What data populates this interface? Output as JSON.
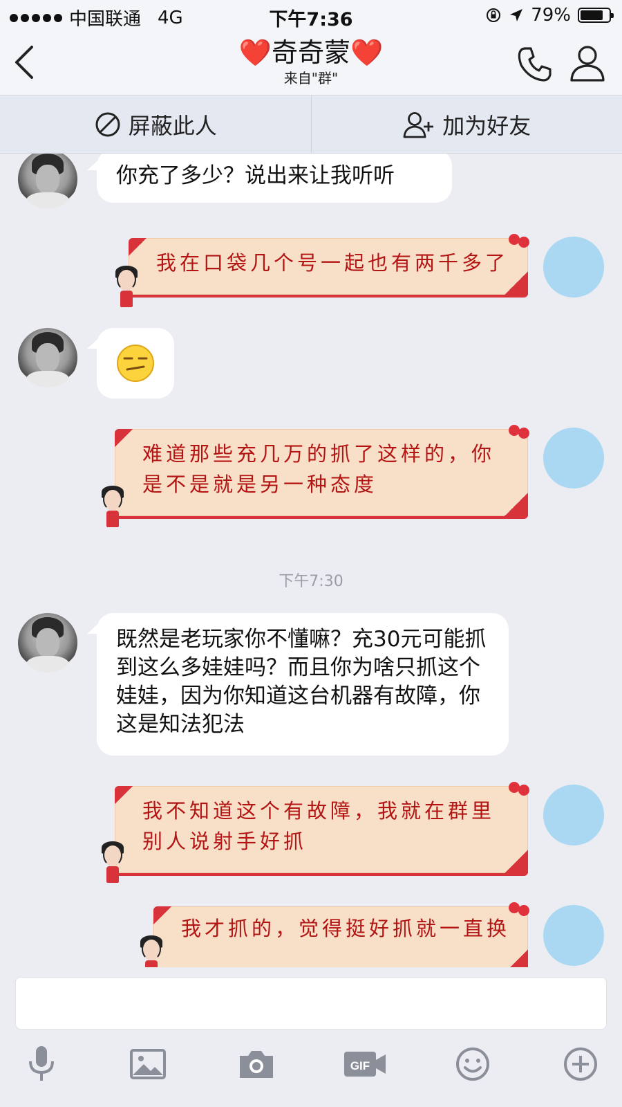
{
  "status_bar": {
    "carrier": "中国联通",
    "network": "4G",
    "time": "下午7:36",
    "battery": "79%",
    "battery_level": 0.79
  },
  "header": {
    "title": "❤️奇奇蒙❤️",
    "subtitle": "来自\"群\"",
    "back_icon": "chevron-left-icon",
    "call_icon": "phone-icon",
    "profile_icon": "person-icon"
  },
  "actions": {
    "block_label": "屏蔽此人",
    "add_friend_label": "加为好友"
  },
  "messages": [
    {
      "side": "left",
      "text": "你充了多少？说出来让我听听"
    },
    {
      "side": "right",
      "text": "我在口袋几个号一起也有两千多了"
    },
    {
      "side": "left",
      "text": "emoji-smirk"
    },
    {
      "side": "right",
      "text": "难道那些充几万的抓了这样的，你是不是就是另一种态度"
    },
    {
      "side": "left",
      "text": "既然是老玩家你不懂嘛？充30元可能抓到这么多娃娃吗？而且你为啥只抓这个娃娃，因为你知道这台机器有故障，你这是知法犯法"
    },
    {
      "side": "right",
      "text": "我不知道这个有故障，我就在群里别人说射手好抓"
    },
    {
      "side": "right",
      "text": "我才抓的，觉得挺好抓就一直换"
    }
  ],
  "timestamp": "下午7:30",
  "input": {
    "placeholder": ""
  },
  "toolbar": [
    "microphone-icon",
    "image-icon",
    "camera-icon",
    "gif-icon",
    "emoji-icon",
    "plus-icon"
  ]
}
